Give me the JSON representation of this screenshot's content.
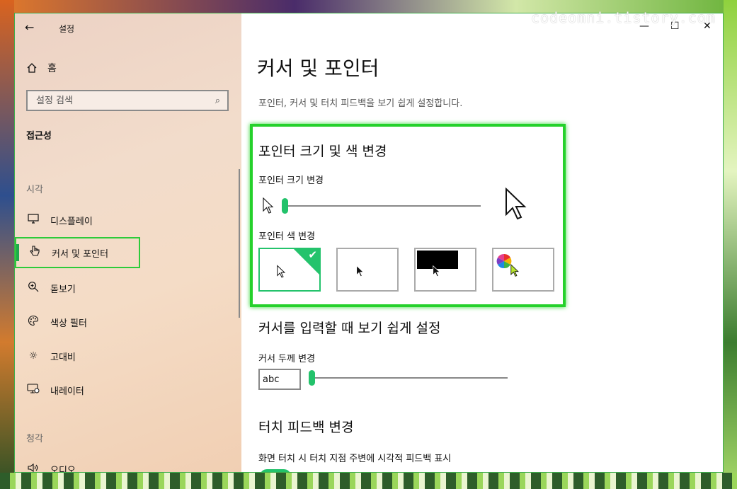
{
  "watermark": "codeomni.tistory.com",
  "window": {
    "app_title": "설정",
    "back_label": "←",
    "minimize": "—",
    "maximize": "☐",
    "close": "✕"
  },
  "sidebar": {
    "home_label": "홈",
    "search_placeholder": "설정 검색",
    "category": "접근성",
    "group_vision": "시각",
    "group_hearing": "청각",
    "items": [
      {
        "label": "디스플레이",
        "icon": "monitor-icon"
      },
      {
        "label": "커서 및 포인터",
        "icon": "hand-pointer-icon",
        "active": true
      },
      {
        "label": "돋보기",
        "icon": "magnifier-icon"
      },
      {
        "label": "색상 필터",
        "icon": "palette-icon"
      },
      {
        "label": "고대비",
        "icon": "sun-icon"
      },
      {
        "label": "내레이터",
        "icon": "narrator-icon"
      },
      {
        "label": "오디오",
        "icon": "speaker-icon"
      }
    ]
  },
  "main": {
    "title": "커서 및 포인터",
    "subtitle": "포인터, 커서 및 터치 피드백을 보기 쉽게 설정합니다.",
    "pointer_section": {
      "title": "포인터 크기 및 색 변경",
      "size_label": "포인터 크기 변경",
      "size_value": 1,
      "color_label": "포인터 색 변경",
      "color_options": [
        "white",
        "black",
        "inverted",
        "custom"
      ],
      "selected_color": "white"
    },
    "cursor_section": {
      "title": "커서를 입력할 때 보기 쉽게 설정",
      "thickness_label": "커서 두께 변경",
      "preview_text": "abc",
      "thickness_value": 1
    },
    "touch_section": {
      "title": "터치 피드백 변경",
      "feedback_label": "화면 터치 시 터치 지점 주변에 시각적 피드백 표시"
    }
  },
  "colors": {
    "accent": "#23c26b",
    "highlight": "#25d12b"
  }
}
